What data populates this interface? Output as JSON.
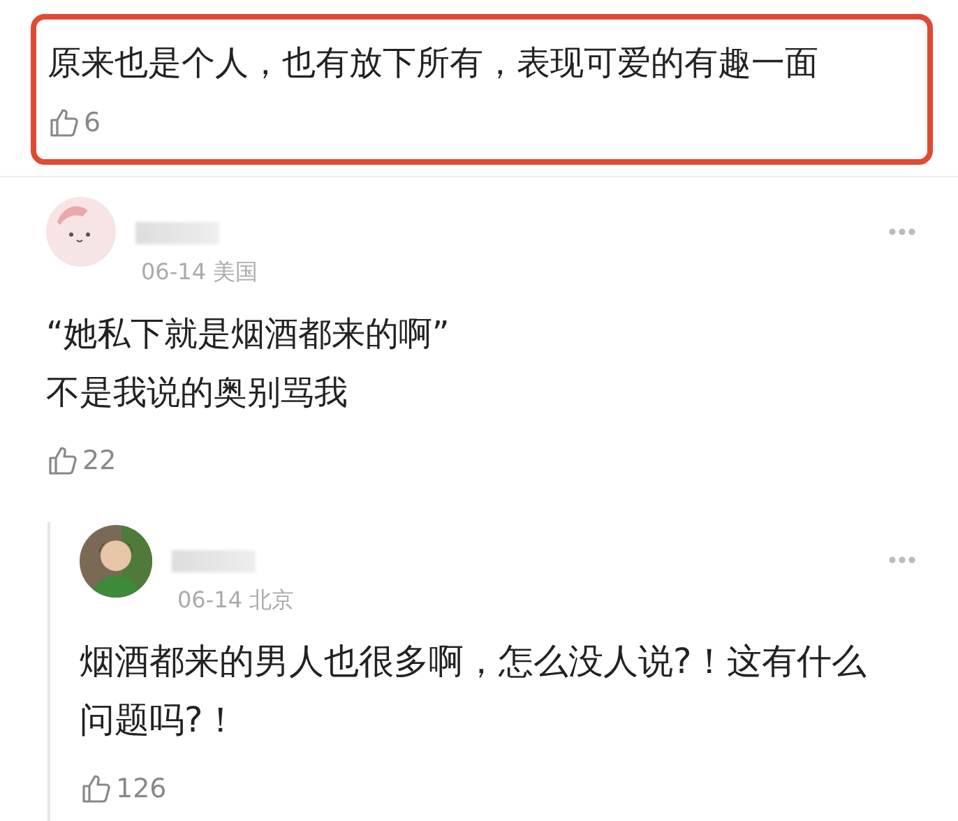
{
  "comments": [
    {
      "kind": "highlighted",
      "lines": [
        "原来也是个人，也有放下所有，表现可爱的有趣一面"
      ],
      "likes": "6"
    },
    {
      "kind": "comment",
      "meta": "06-14 美国",
      "lines": [
        "“她私下就是烟酒都来的啊”",
        "不是我说的奥别骂我"
      ],
      "likes": "22"
    },
    {
      "kind": "reply",
      "meta": "06-14 北京",
      "lines": [
        "烟酒都来的男人也很多啊，怎么没人说?！这有什么",
        "问题吗?！"
      ],
      "likes": "126"
    }
  ]
}
